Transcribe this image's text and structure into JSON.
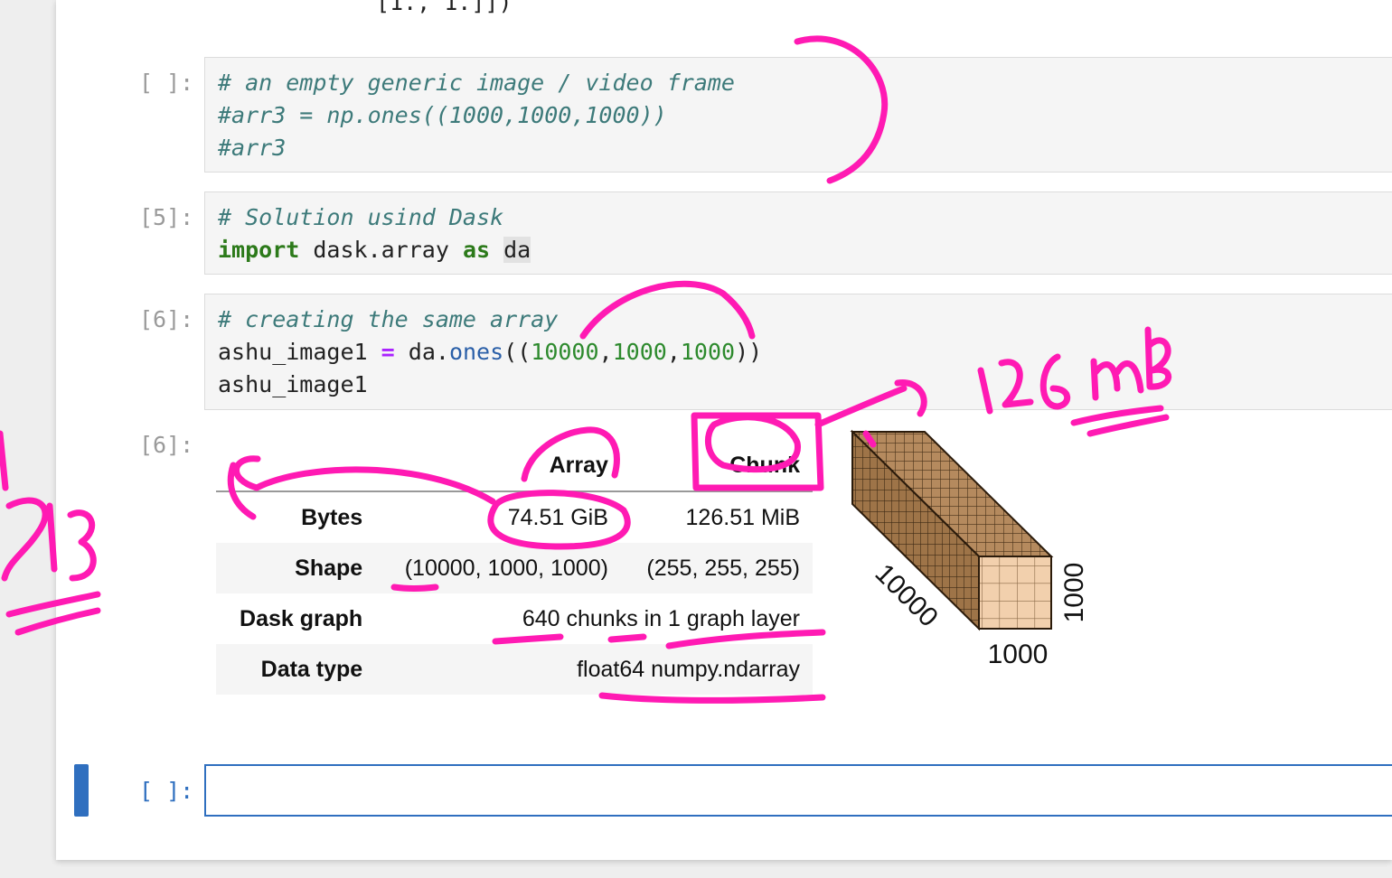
{
  "previous_output": {
    "line_2": "[1., 1.]])"
  },
  "cells": [
    {
      "prompt": "[ ]:",
      "lines": [
        "# an empty generic image / video frame",
        "#arr3 = np.ones((1000,1000,1000))",
        "#arr3"
      ]
    },
    {
      "prompt": "[5]:",
      "comment": "# Solution usind Dask",
      "import_kw": "import",
      "module": "dask.array",
      "as_kw": "as",
      "alias": "da"
    },
    {
      "prompt": "[6]:",
      "comment": "# creating the same array",
      "var": "ashu_image1",
      "eq": "=",
      "obj": "da",
      "dot": ".",
      "func": "ones",
      "open": "((",
      "n1": "10000",
      "c1": ",",
      "n2": "1000",
      "c2": ",",
      "n3": "1000",
      "close": "))",
      "last": "ashu_image1"
    }
  ],
  "output": {
    "prompt": "[6]:",
    "header": {
      "array": "Array",
      "chunk": "Chunk"
    },
    "rows": [
      {
        "label": "Bytes",
        "array": "74.51 GiB",
        "chunk": "126.51 MiB"
      },
      {
        "label": "Shape",
        "array": "(10000, 1000, 1000)",
        "chunk": "(255, 255, 255)"
      },
      {
        "label": "Dask graph",
        "value": "640 chunks in 1 graph layer"
      },
      {
        "label": "Data type",
        "value": "float64 numpy.ndarray"
      }
    ],
    "cube_labels": {
      "depth": "10000",
      "width": "1000",
      "height": "1000"
    }
  },
  "active_cell": {
    "prompt": "[ ]:",
    "value": ""
  },
  "annotations": {
    "handwritten": "126 mb",
    "ink_color": "#ff1ab3"
  }
}
